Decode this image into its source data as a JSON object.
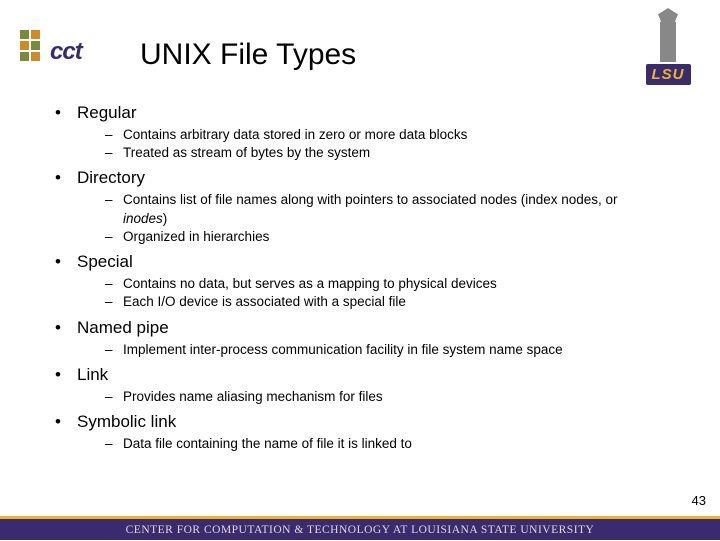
{
  "logos": {
    "cct_text": "cct",
    "lsu_text": "LSU"
  },
  "title": "UNIX File Types",
  "items": [
    {
      "label": "Regular",
      "subs": [
        {
          "text": "Contains arbitrary data stored in zero or more data blocks"
        },
        {
          "text": "Treated as stream of bytes by the system"
        }
      ]
    },
    {
      "label": "Directory",
      "subs": [
        {
          "text_html": "Contains list of file names along with pointers to associated nodes (index nodes, or <span class='italic'>inodes</span>)"
        },
        {
          "text": "Organized in hierarchies"
        }
      ]
    },
    {
      "label": "Special",
      "subs": [
        {
          "text": "Contains no data, but serves as a mapping to physical devices"
        },
        {
          "text": "Each I/O device is associated with a special file"
        }
      ]
    },
    {
      "label": "Named pipe",
      "subs": [
        {
          "text": "Implement inter-process communication facility in file system name space"
        }
      ]
    },
    {
      "label": "Link",
      "subs": [
        {
          "text": "Provides name aliasing mechanism for files"
        }
      ]
    },
    {
      "label": "Symbolic link",
      "subs": [
        {
          "text": "Data file containing the name of file it is linked to"
        }
      ]
    }
  ],
  "page_number": "43",
  "footer": "CENTER FOR COMPUTATION & TECHNOLOGY AT LOUISIANA STATE UNIVERSITY"
}
